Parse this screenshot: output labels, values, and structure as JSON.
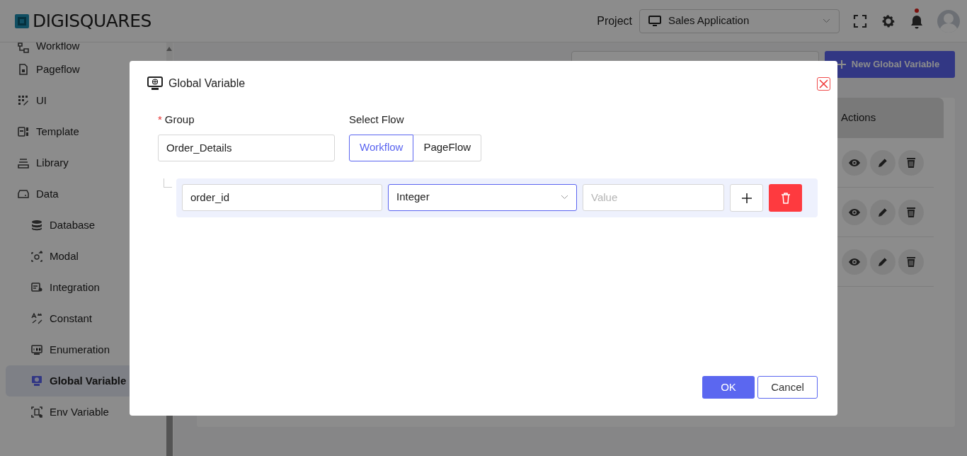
{
  "header": {
    "logo_text": "DIGISQUARES",
    "project_label": "Project",
    "project_select": "Sales Application",
    "notifications_unread": true
  },
  "sidebar": {
    "items": [
      {
        "label": "Workflow",
        "selected": false
      },
      {
        "label": "Pageflow",
        "selected": false
      },
      {
        "label": "UI",
        "selected": false
      },
      {
        "label": "Template",
        "selected": false
      },
      {
        "label": "Library",
        "selected": false
      },
      {
        "label": "Data",
        "selected": false,
        "children": [
          {
            "label": "Database",
            "selected": false
          },
          {
            "label": "Modal",
            "selected": false
          },
          {
            "label": "Integration",
            "selected": false
          },
          {
            "label": "Constant",
            "selected": false
          },
          {
            "label": "Enumeration",
            "selected": false
          },
          {
            "label": "Global Variable",
            "selected": true
          },
          {
            "label": "Env Variable",
            "selected": false
          }
        ]
      }
    ]
  },
  "page": {
    "new_button": "New Global Variable",
    "table": {
      "columns": [
        "Actions"
      ],
      "rows": [
        {
          "actions": [
            {
              "kind": "view"
            },
            {
              "kind": "edit"
            },
            {
              "kind": "delete"
            }
          ]
        },
        {
          "actions": [
            {
              "kind": "view"
            },
            {
              "kind": "edit"
            },
            {
              "kind": "delete"
            }
          ]
        },
        {
          "actions": [
            {
              "kind": "view"
            },
            {
              "kind": "edit"
            },
            {
              "kind": "delete"
            }
          ]
        }
      ]
    }
  },
  "modal": {
    "title": "Global Variable",
    "group": {
      "label": "Group",
      "required": true,
      "required_mark": "*",
      "value": "Order_Details"
    },
    "select_flow": {
      "label": "Select Flow",
      "options": [
        {
          "label": "Workflow",
          "selected": true
        },
        {
          "label": "PageFlow",
          "selected": false
        }
      ]
    },
    "variables": [
      {
        "name": "order_id",
        "type": "Integer",
        "type_focused": true,
        "value_placeholder": "Value"
      }
    ],
    "buttons": {
      "ok": "OK",
      "cancel": "Cancel"
    }
  }
}
